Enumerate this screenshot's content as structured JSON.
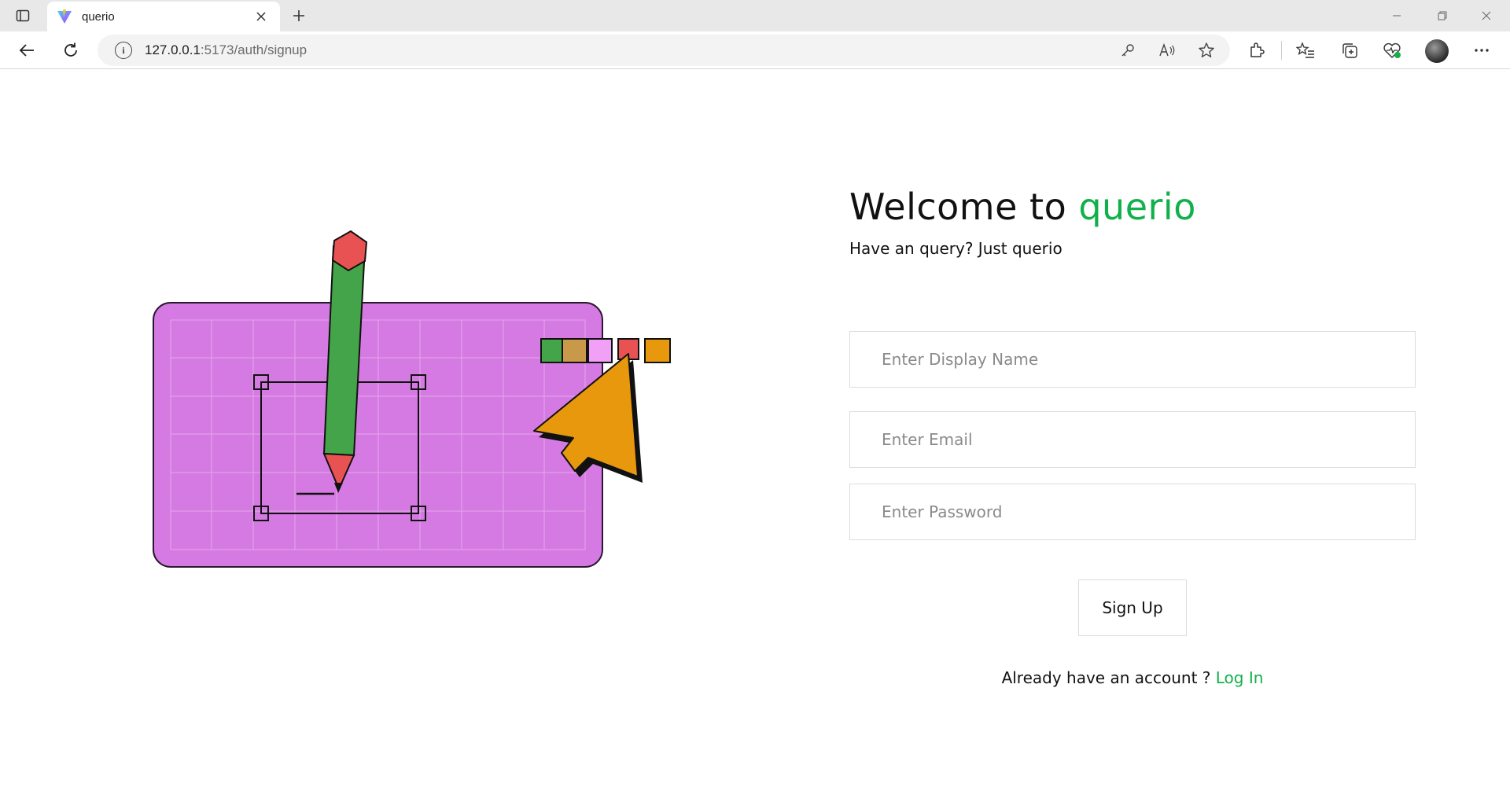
{
  "browser": {
    "tab_title": "querio",
    "url_host": "127.0.0.1",
    "url_rest": ":5173/auth/signup",
    "window_controls": [
      "minimize-icon",
      "restore-icon",
      "close-icon"
    ]
  },
  "page": {
    "welcome_prefix": "Welcome to ",
    "brand": "querio",
    "tagline": "Have an query? Just querio",
    "fields": {
      "display_name_placeholder": "Enter Display Name",
      "email_placeholder": "Enter Email",
      "password_placeholder": "Enter Password"
    },
    "signup_label": "Sign Up",
    "login_prompt": "Already have an account ? ",
    "login_link": "Log In"
  },
  "colors": {
    "brand_green": "#12b04a",
    "illustration_board": "#d57ae2",
    "pencil_green": "#44a449",
    "pencil_red": "#e85252",
    "cursor_orange": "#e8980d",
    "swatches": [
      "#44a449",
      "#c9994a",
      "#f0a0f5",
      "#e85252",
      "#e8980d"
    ]
  }
}
